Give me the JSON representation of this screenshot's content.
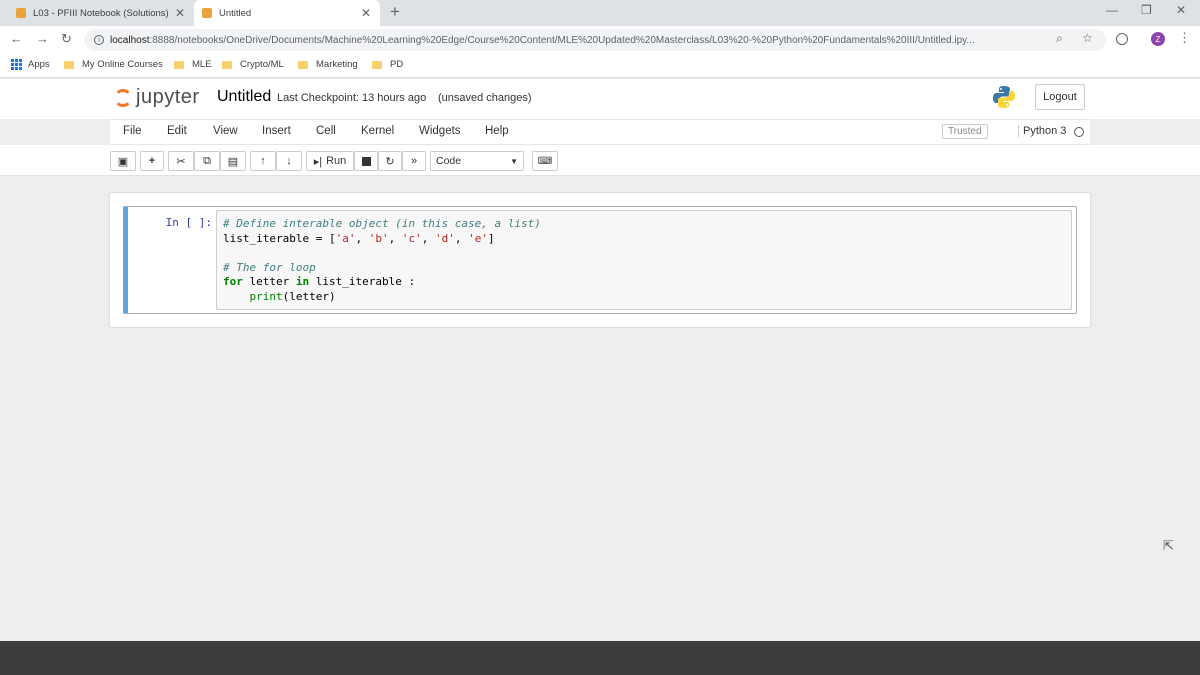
{
  "browser": {
    "tabs": [
      {
        "title": "L03 - PFIII Notebook (Solutions)",
        "active": false
      },
      {
        "title": "Untitled",
        "active": true
      }
    ],
    "new_tab_icon": "plus-icon",
    "url_host": "localhost",
    "url_rest": ":8888/notebooks/OneDrive/Documents/Machine%20Learning%20Edge/Course%20Content/MLE%20Updated%20Masterclass/L03%20-%20Python%20Fundamentals%20III/Untitled.ipy...",
    "avatar_letter": "Z",
    "bookmarks": {
      "apps": "Apps",
      "items": [
        "My Online Courses",
        "MLE",
        "Crypto/ML",
        "Marketing",
        "PD"
      ]
    }
  },
  "jupyter": {
    "logo_text": "jupyter",
    "notebook_name": "Untitled",
    "checkpoint": "Last Checkpoint: 13 hours ago",
    "unsaved": "(unsaved changes)",
    "logout": "Logout",
    "menu": [
      "File",
      "Edit",
      "View",
      "Insert",
      "Cell",
      "Kernel",
      "Widgets",
      "Help"
    ],
    "trusted": "Trusted",
    "kernel_name": "Python 3",
    "toolbar": {
      "run_label": "Run",
      "cell_type": "Code"
    },
    "cell": {
      "prompt": "In [ ]:",
      "lines": [
        [
          {
            "t": "# Define interable object (in this case, a list)",
            "c": "cm-comment"
          }
        ],
        [
          {
            "t": "list_iterable = [",
            "c": ""
          },
          {
            "t": "'a'",
            "c": "cm-string"
          },
          {
            "t": ", ",
            "c": ""
          },
          {
            "t": "'b'",
            "c": "cm-string"
          },
          {
            "t": ", ",
            "c": ""
          },
          {
            "t": "'c'",
            "c": "cm-string"
          },
          {
            "t": ", ",
            "c": ""
          },
          {
            "t": "'d'",
            "c": "cm-string"
          },
          {
            "t": ", ",
            "c": ""
          },
          {
            "t": "'e'",
            "c": "cm-string"
          },
          {
            "t": "]",
            "c": ""
          }
        ],
        [
          {
            "t": "",
            "c": ""
          }
        ],
        [
          {
            "t": "# The for loop",
            "c": "cm-comment"
          }
        ],
        [
          {
            "t": "for",
            "c": "cm-keyword"
          },
          {
            "t": " letter ",
            "c": ""
          },
          {
            "t": "in",
            "c": "cm-keyword"
          },
          {
            "t": " list_iterable :",
            "c": ""
          }
        ],
        [
          {
            "t": "    ",
            "c": ""
          },
          {
            "t": "print",
            "c": "cm-builtin"
          },
          {
            "t": "(letter)",
            "c": ""
          }
        ]
      ]
    }
  },
  "colors": {
    "cell_selected_border": "#66a3d8",
    "jupyter_orange": "#f37726"
  }
}
